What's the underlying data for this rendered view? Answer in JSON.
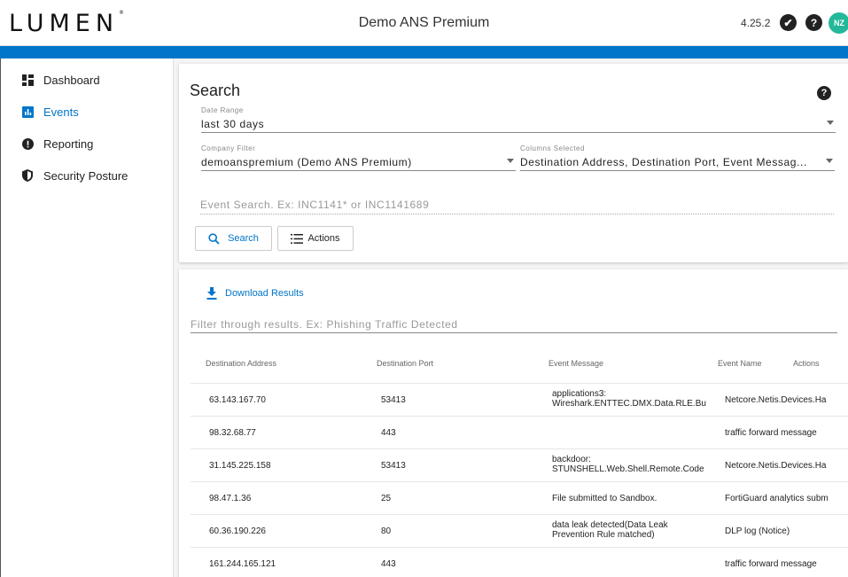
{
  "header": {
    "logo": "LUMEN",
    "logo_mark": "®",
    "title": "Demo ANS Premium",
    "version": "4.25.2",
    "avatar_initials": "NZ",
    "check_glyph": "✔",
    "help_glyph": "?"
  },
  "colors": {
    "accent": "#0075c9",
    "avatar": "#23b899"
  },
  "sidebar": {
    "items": [
      {
        "label": "Dashboard",
        "icon": "dashboard-icon",
        "active": false
      },
      {
        "label": "Events",
        "icon": "bar-chart-icon",
        "active": true
      },
      {
        "label": "Reporting",
        "icon": "alert-circle-icon",
        "active": false
      },
      {
        "label": "Security Posture",
        "icon": "shield-icon",
        "active": false
      }
    ]
  },
  "search": {
    "title": "Search",
    "help_glyph": "?",
    "date_range": {
      "label": "Date Range",
      "value": "last 30 days"
    },
    "company_filter": {
      "label": "Company Filter",
      "value": "demoanspremium (Demo ANS Premium)"
    },
    "columns_selected": {
      "label": "Columns Selected",
      "value": "Destination Address, Destination Port, Event Messag..."
    },
    "event_search_placeholder": "Event Search. Ex: INC1141* or INC1141689",
    "search_button": "Search",
    "actions_button": "Actions"
  },
  "results": {
    "download_label": "Download Results",
    "filter_placeholder": "Filter through results. Ex: Phishing Traffic Detected",
    "columns": [
      "Destination Address",
      "Destination Port",
      "Event Message",
      "Event Name",
      "Actions"
    ],
    "rows": [
      {
        "address": "63.143.167.70",
        "port": "53413",
        "message_1": "applications3:",
        "message_2": "Wireshark.ENTTEC.DMX.Data.RLE.Bu",
        "name": "Netcore.Netis.Devices.Ha"
      },
      {
        "address": "98.32.68.77",
        "port": "443",
        "message_1": "",
        "message_2": "",
        "name": "traffic forward message"
      },
      {
        "address": "31.145.225.158",
        "port": "53413",
        "message_1": "backdoor:",
        "message_2": "STUNSHELL.Web.Shell.Remote.Code",
        "name": "Netcore.Netis.Devices.Ha"
      },
      {
        "address": "98.47.1.36",
        "port": "25",
        "message_1": "File submitted to Sandbox.",
        "message_2": "",
        "name": "FortiGuard analytics subm"
      },
      {
        "address": "60.36.190.226",
        "port": "80",
        "message_1": "data leak detected(Data Leak",
        "message_2": "Prevention Rule matched)",
        "name": "DLP log (Notice)"
      },
      {
        "address": "161.244.165.121",
        "port": "443",
        "message_1": "",
        "message_2": "",
        "name": "traffic forward message"
      }
    ]
  }
}
